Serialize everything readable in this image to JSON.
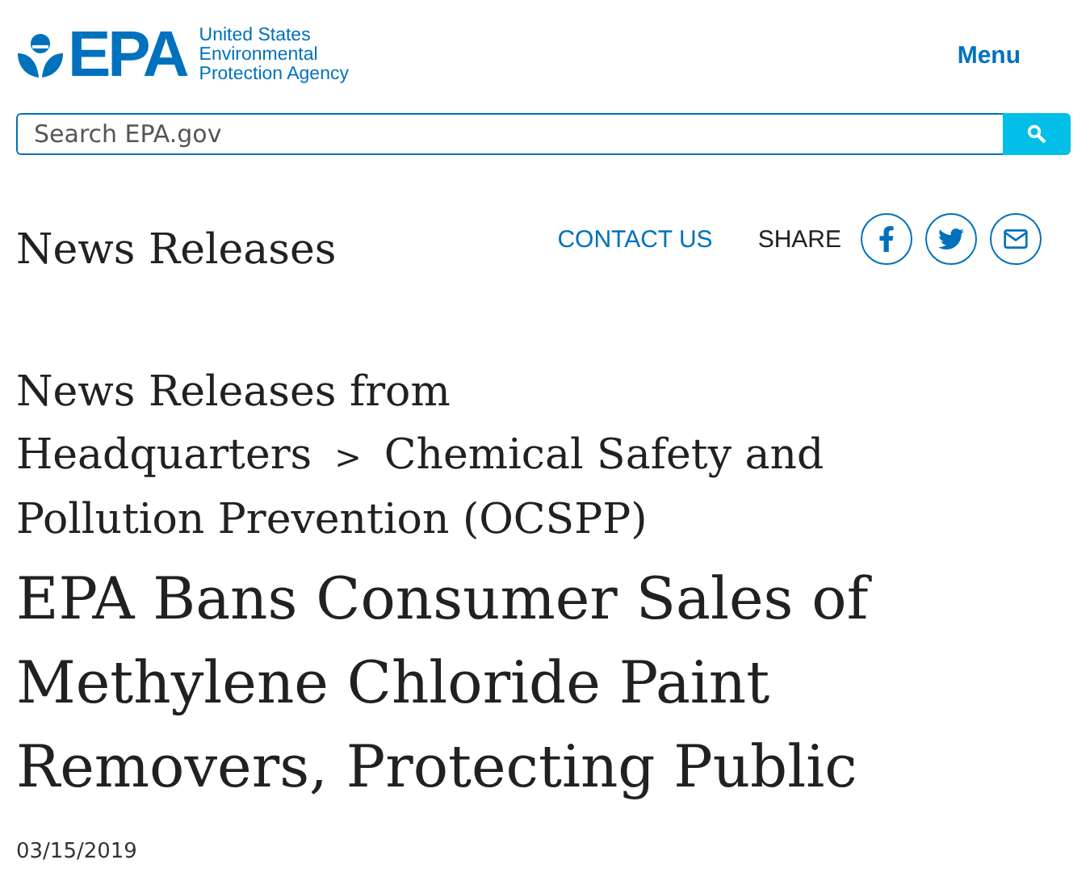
{
  "header": {
    "logo_text": "EPA",
    "agency_lines": [
      "United States",
      "Environmental",
      "Protection Agency"
    ],
    "menu": "Menu"
  },
  "search": {
    "placeholder": "Search EPA.gov"
  },
  "section_title": "News Releases",
  "actions": {
    "contact": "CONTACT US",
    "share_label": "SHARE",
    "share_buttons": [
      {
        "kind": "facebook"
      },
      {
        "kind": "twitter"
      },
      {
        "kind": "email"
      }
    ]
  },
  "breadcrumb": {
    "prefix": "News Releases from",
    "items": [
      {
        "lines": [
          "Headquarters"
        ]
      },
      {
        "lines": [
          "Chemical Safety and",
          "Pollution Prevention (OCSPP)"
        ]
      }
    ],
    "separator": ">"
  },
  "article": {
    "title": "EPA Bans Consumer Sales of Methylene Chloride Paint Removers, Protecting Public",
    "date": "03/15/2019"
  }
}
